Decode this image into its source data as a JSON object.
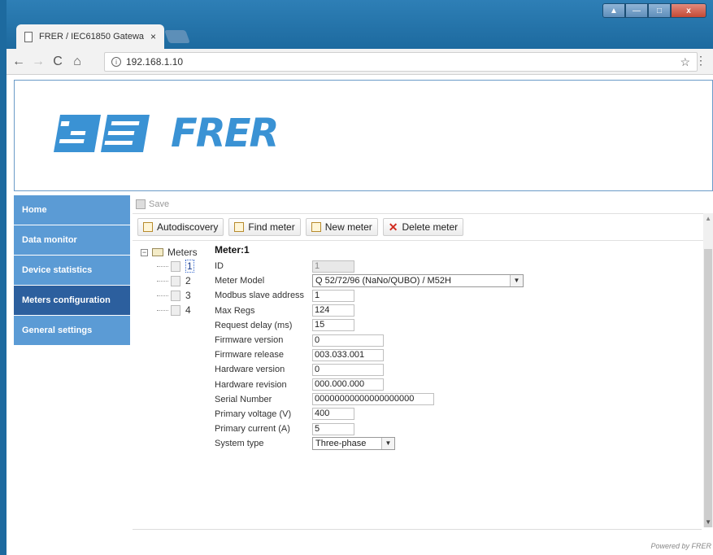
{
  "browser": {
    "tab_title": "FRER / IEC61850 Gatewa",
    "tab_close": "×",
    "url": "192.168.1.10",
    "info_glyph": "i",
    "star_glyph": "☆",
    "menu_glyph": "⋮",
    "back_glyph": "←",
    "forward_glyph": "→",
    "reload_glyph": "C",
    "home_glyph": "⌂",
    "win_user": "▲",
    "win_min": "—",
    "win_max": "□",
    "win_close": "x"
  },
  "logo_text": "FRER",
  "sidebar": {
    "items": [
      {
        "label": "Home"
      },
      {
        "label": "Data monitor"
      },
      {
        "label": "Device statistics"
      },
      {
        "label": "Meters configuration",
        "active": true
      },
      {
        "label": "General settings"
      }
    ]
  },
  "toolbar": {
    "save_label": "Save",
    "autodiscovery_label": "Autodiscovery",
    "find_meter_label": "Find meter",
    "new_meter_label": "New meter",
    "delete_meter_label": "Delete meter",
    "delete_glyph": "✕"
  },
  "tree": {
    "expander": "−",
    "root_label": "Meters",
    "children": [
      "1",
      "2",
      "3",
      "4"
    ],
    "selected_index": 0
  },
  "meter_form": {
    "title": "Meter:1",
    "fields": {
      "id": {
        "label": "ID",
        "value": "1"
      },
      "meter_model": {
        "label": "Meter Model",
        "value": "Q 52/72/96 (NaNo/QUBO) / M52H"
      },
      "modbus_slave_address": {
        "label": "Modbus slave address",
        "value": "1"
      },
      "max_regs": {
        "label": "Max Regs",
        "value": "124"
      },
      "request_delay": {
        "label": "Request delay (ms)",
        "value": "15"
      },
      "firmware_version": {
        "label": "Firmware version",
        "value": "0"
      },
      "firmware_release": {
        "label": "Firmware release",
        "value": "003.033.001"
      },
      "hardware_version": {
        "label": "Hardware version",
        "value": "0"
      },
      "hardware_revision": {
        "label": "Hardware revision",
        "value": "000.000.000"
      },
      "serial_number": {
        "label": "Serial Number",
        "value": "00000000000000000000"
      },
      "primary_voltage": {
        "label": "Primary voltage (V)",
        "value": "400"
      },
      "primary_current": {
        "label": "Primary current (A)",
        "value": "5"
      },
      "system_type": {
        "label": "System type",
        "value": "Three-phase"
      }
    },
    "select_arrow": "▼"
  },
  "scroll": {
    "up": "▲",
    "down": "▼"
  },
  "footer_text": "Powered by FRER",
  "colors": {
    "sidebar": "#5b9bd5",
    "sidebar_active": "#2c5f9e",
    "logo": "#3a92d4",
    "browser_frame": "#1d6a9f"
  }
}
